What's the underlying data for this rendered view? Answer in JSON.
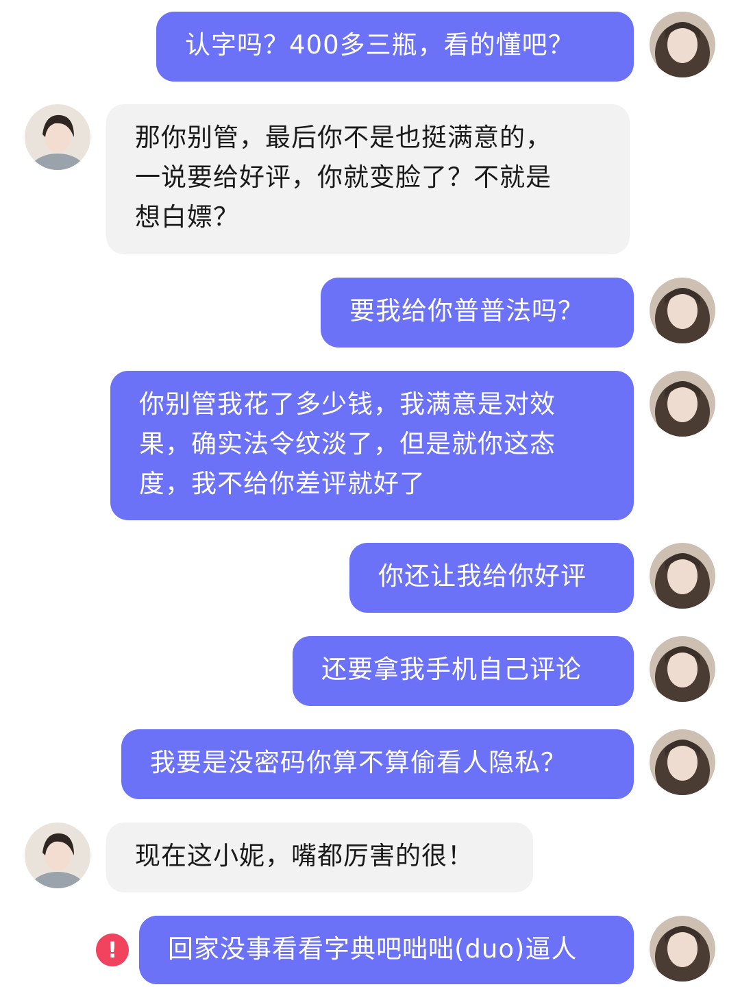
{
  "messages": [
    {
      "side": "sent",
      "text": "认字吗？400多三瓶，看的懂吧？"
    },
    {
      "side": "received",
      "text": "那你别管，最后你不是也挺满意的，\n一说要给好评，你就变脸了？不就是\n想白嫖？"
    },
    {
      "side": "sent",
      "text": "要我给你普普法吗？"
    },
    {
      "side": "sent",
      "text": "你别管我花了多少钱，我满意是对效\n果，确实法令纹淡了，但是就你这态\n度，我不给你差评就好了"
    },
    {
      "side": "sent",
      "text": "你还让我给你好评"
    },
    {
      "side": "sent",
      "text": "还要拿我手机自己评论"
    },
    {
      "side": "sent",
      "text": "我要是没密码你算不算偷看人隐私？"
    },
    {
      "side": "received",
      "text": "现在这小妮，嘴都厉害的很！"
    },
    {
      "side": "sent",
      "text": "回家没事看看字典吧咄咄(duo)逼人",
      "failed": true
    }
  ],
  "error_badge": "!",
  "colors": {
    "sent_bubble": "#6b72f7",
    "received_bubble": "#f2f2f2",
    "error": "#f2435e"
  },
  "icons": {
    "self_avatar": "user-avatar-icon",
    "other_avatar": "contact-avatar-icon",
    "send_failed": "exclamation-circle-icon"
  }
}
